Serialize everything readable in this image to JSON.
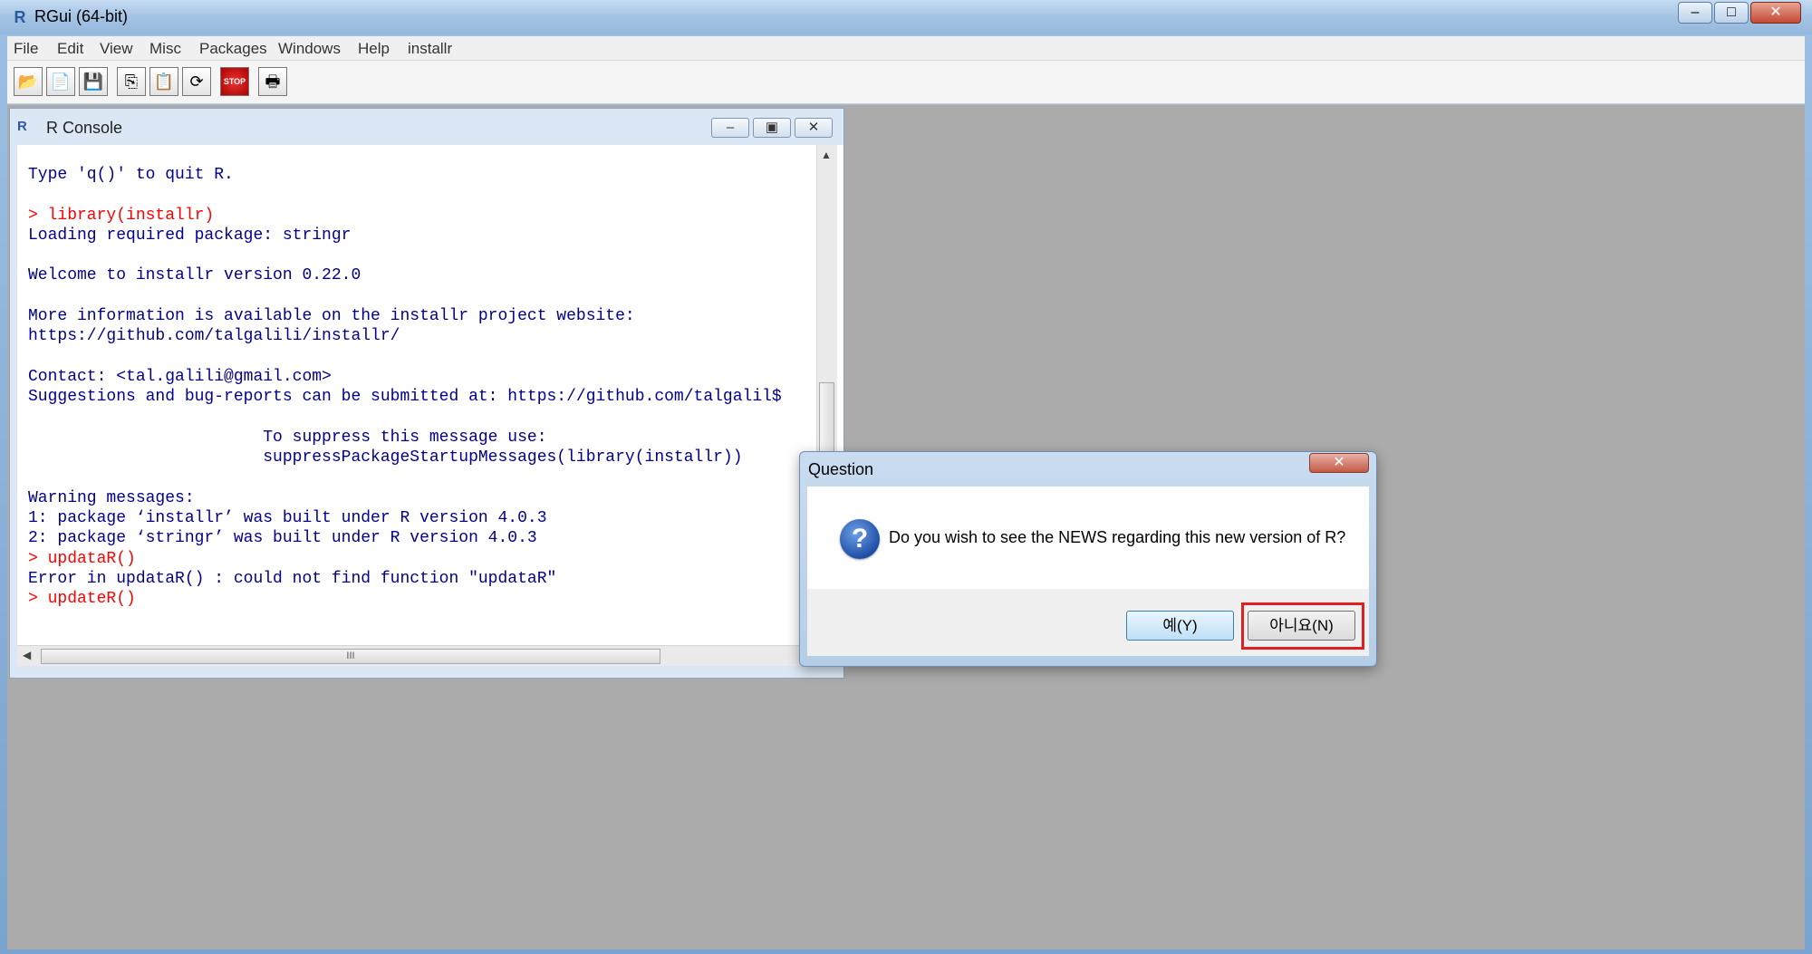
{
  "window": {
    "title": "RGui (64-bit)",
    "min_icon": "–",
    "max_icon": "□",
    "close_icon": "✕"
  },
  "menu": [
    "File",
    "Edit",
    "View",
    "Misc",
    "Packages",
    "Windows",
    "Help",
    "installr"
  ],
  "toolbar": [
    {
      "name": "open-script-icon",
      "glyph": "📂"
    },
    {
      "name": "load-workspace-icon",
      "glyph": "📄"
    },
    {
      "name": "save-workspace-icon",
      "glyph": "💾"
    },
    {
      "name": "copy-icon",
      "glyph": "⎘"
    },
    {
      "name": "paste-icon",
      "glyph": "📋"
    },
    {
      "name": "copy-paste-icon",
      "glyph": "⟳"
    },
    {
      "name": "stop-icon",
      "glyph": "STOP"
    },
    {
      "name": "print-icon",
      "glyph": "🖶"
    }
  ],
  "console": {
    "title": "R Console",
    "min_icon": "–",
    "max_icon": "▣",
    "close_icon": "✕",
    "scroll_grip": "III",
    "lines": [
      {
        "text": "Type 'q()' to quit R.",
        "color": "blue"
      },
      {
        "text": "",
        "color": "blue"
      },
      {
        "text": "> library(installr)",
        "color": "red"
      },
      {
        "text": "Loading required package: stringr",
        "color": "blue"
      },
      {
        "text": "",
        "color": "blue"
      },
      {
        "text": "Welcome to installr version 0.22.0",
        "color": "blue"
      },
      {
        "text": "",
        "color": "blue"
      },
      {
        "text": "More information is available on the installr project website:",
        "color": "blue"
      },
      {
        "text": "https://github.com/talgalili/installr/",
        "color": "blue"
      },
      {
        "text": "",
        "color": "blue"
      },
      {
        "text": "Contact: <tal.galili@gmail.com>",
        "color": "blue"
      },
      {
        "text": "Suggestions and bug-reports can be submitted at: https://github.com/talgalil$",
        "color": "blue"
      },
      {
        "text": "",
        "color": "blue"
      },
      {
        "text": "                        To suppress this message use:",
        "color": "blue"
      },
      {
        "text": "                        suppressPackageStartupMessages(library(installr))",
        "color": "blue"
      },
      {
        "text": "",
        "color": "blue"
      },
      {
        "text": "Warning messages:",
        "color": "blue"
      },
      {
        "text": "1: package ‘installr’ was built under R version 4.0.3",
        "color": "blue"
      },
      {
        "text": "2: package ‘stringr’ was built under R version 4.0.3",
        "color": "blue"
      },
      {
        "text": "> updataR()",
        "color": "red"
      },
      {
        "text": "Error in updataR() : could not find function \"updataR\"",
        "color": "blue"
      },
      {
        "text": "> updateR()",
        "color": "red"
      }
    ]
  },
  "dialog": {
    "title": "Question",
    "close_icon": "✕",
    "icon_glyph": "?",
    "message": "Do you wish to see the NEWS regarding this new version of R?",
    "yes_label": "예(Y)",
    "no_label": "아니요(N)"
  },
  "colors": {
    "console_output": "#00008b",
    "console_input": "#ff0000",
    "highlight": "#e02020"
  }
}
